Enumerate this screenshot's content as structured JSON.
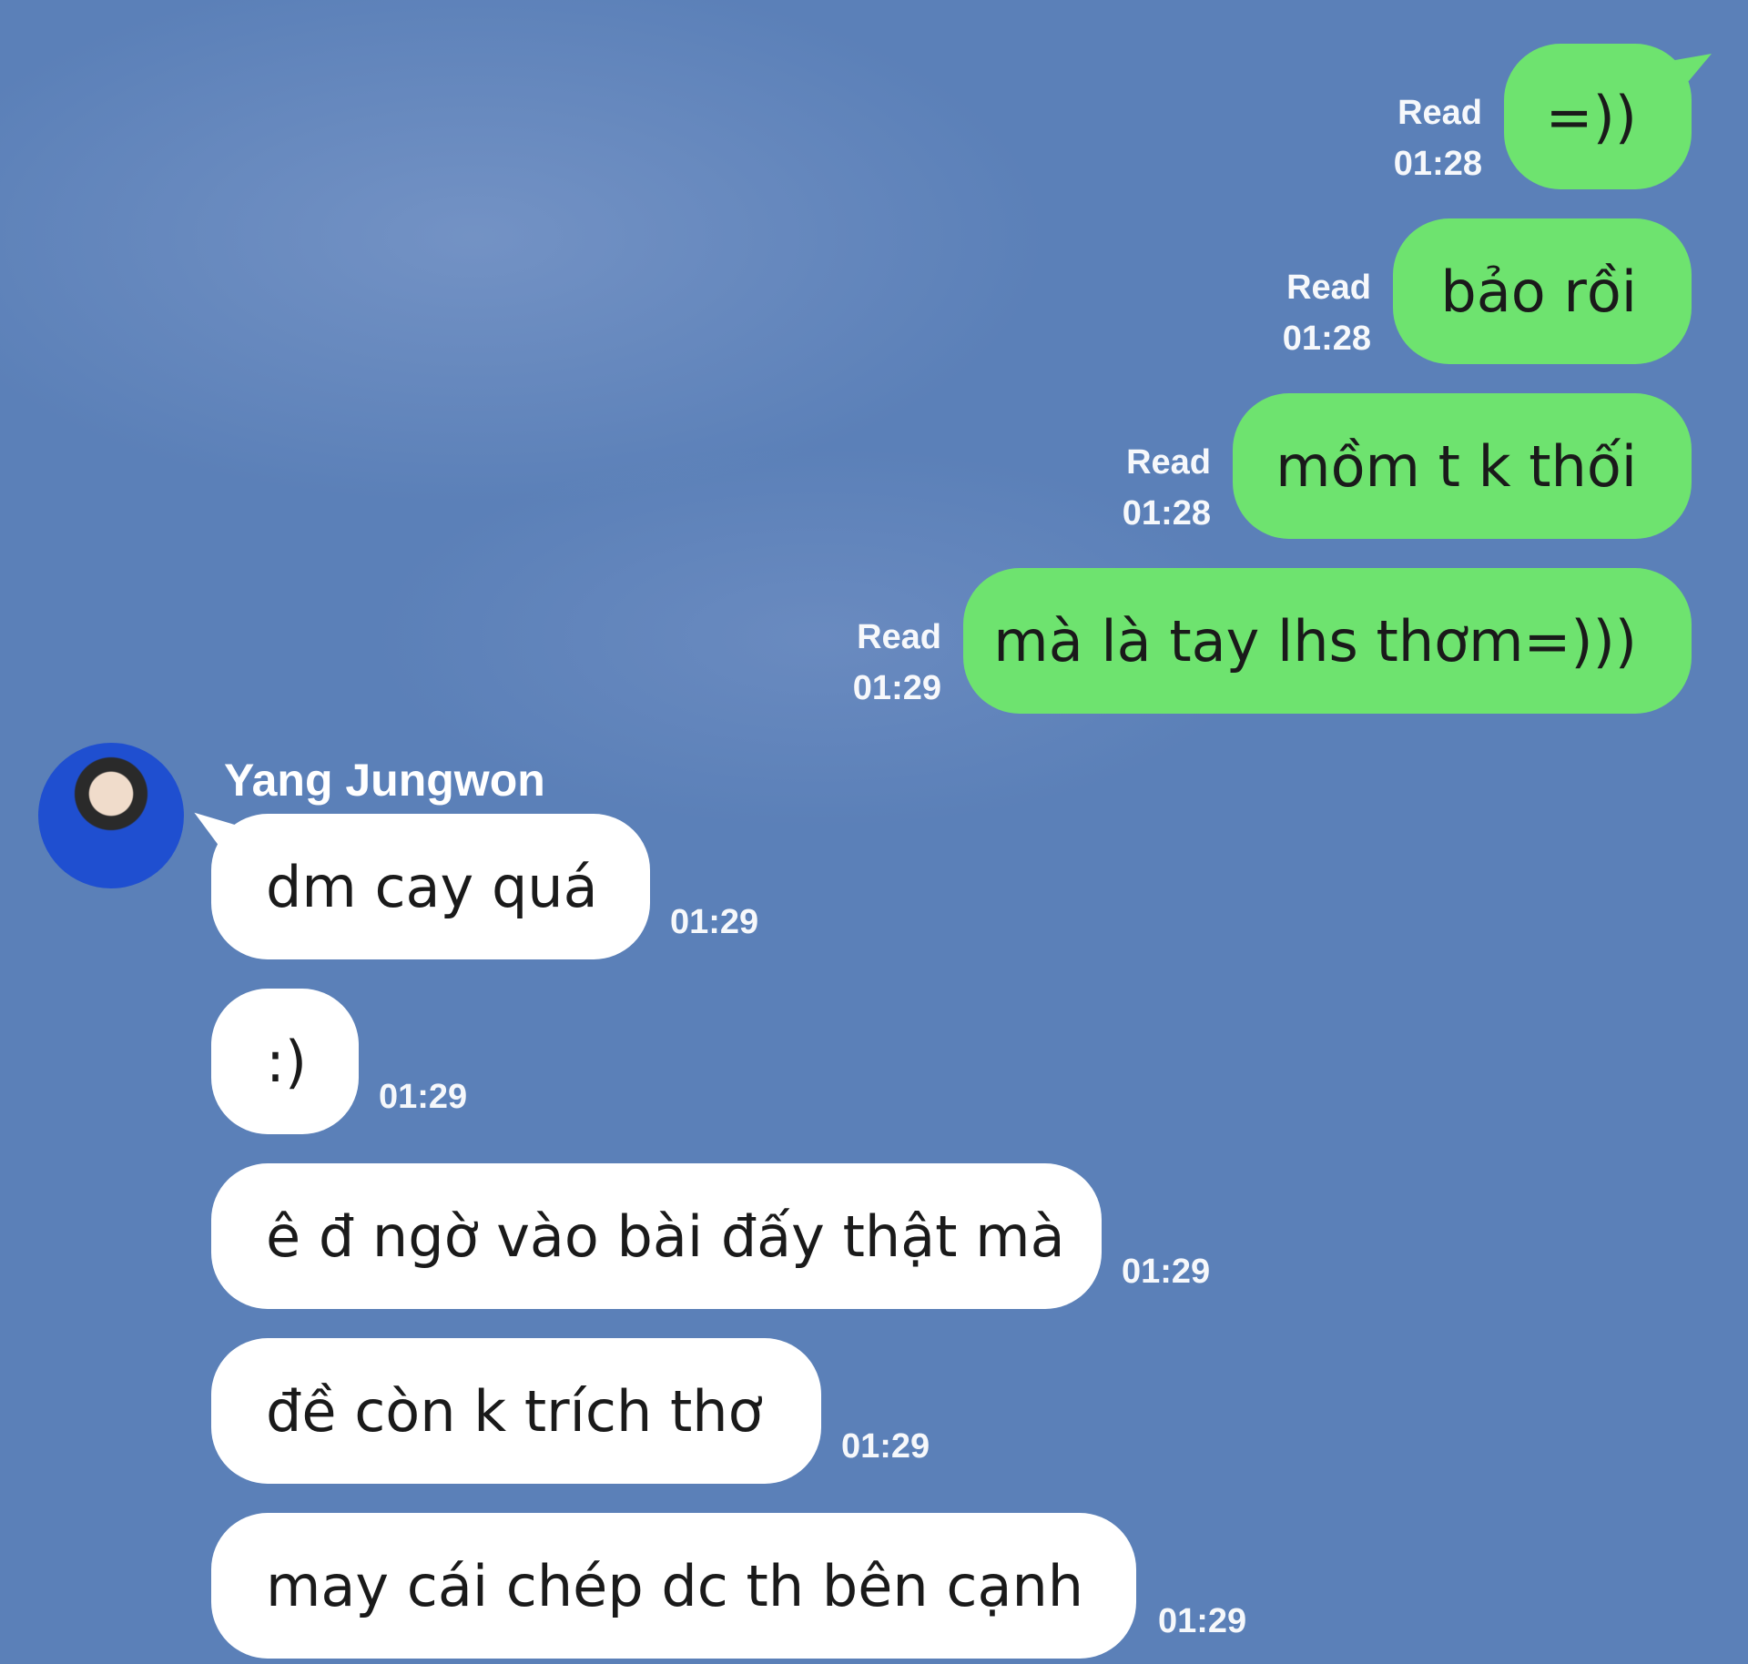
{
  "outgoing_messages": [
    {
      "text": "=))",
      "status": "Read",
      "time": "01:28"
    },
    {
      "text": "bảo rồi",
      "status": "Read",
      "time": "01:28"
    },
    {
      "text": "mồm t k thối",
      "status": "Read",
      "time": "01:28"
    },
    {
      "text": "mà là tay lhs thơm=)))",
      "status": "Read",
      "time": "01:29"
    }
  ],
  "sender": {
    "name": "Yang Jungwon"
  },
  "incoming_messages": [
    {
      "text": "dm cay quá",
      "time": "01:29"
    },
    {
      "text": ":)",
      "time": "01:29"
    },
    {
      "text": "ê đ ngờ vào bài đấy thật mà",
      "time": "01:29"
    },
    {
      "text": "đề còn k trích thơ",
      "time": "01:29"
    },
    {
      "text": "may cái chép dc th bên cạnh",
      "time": "01:29"
    }
  ],
  "colors": {
    "background": "#5b80b8",
    "outgoing_bubble": "#6ee36f",
    "incoming_bubble": "#ffffff"
  }
}
